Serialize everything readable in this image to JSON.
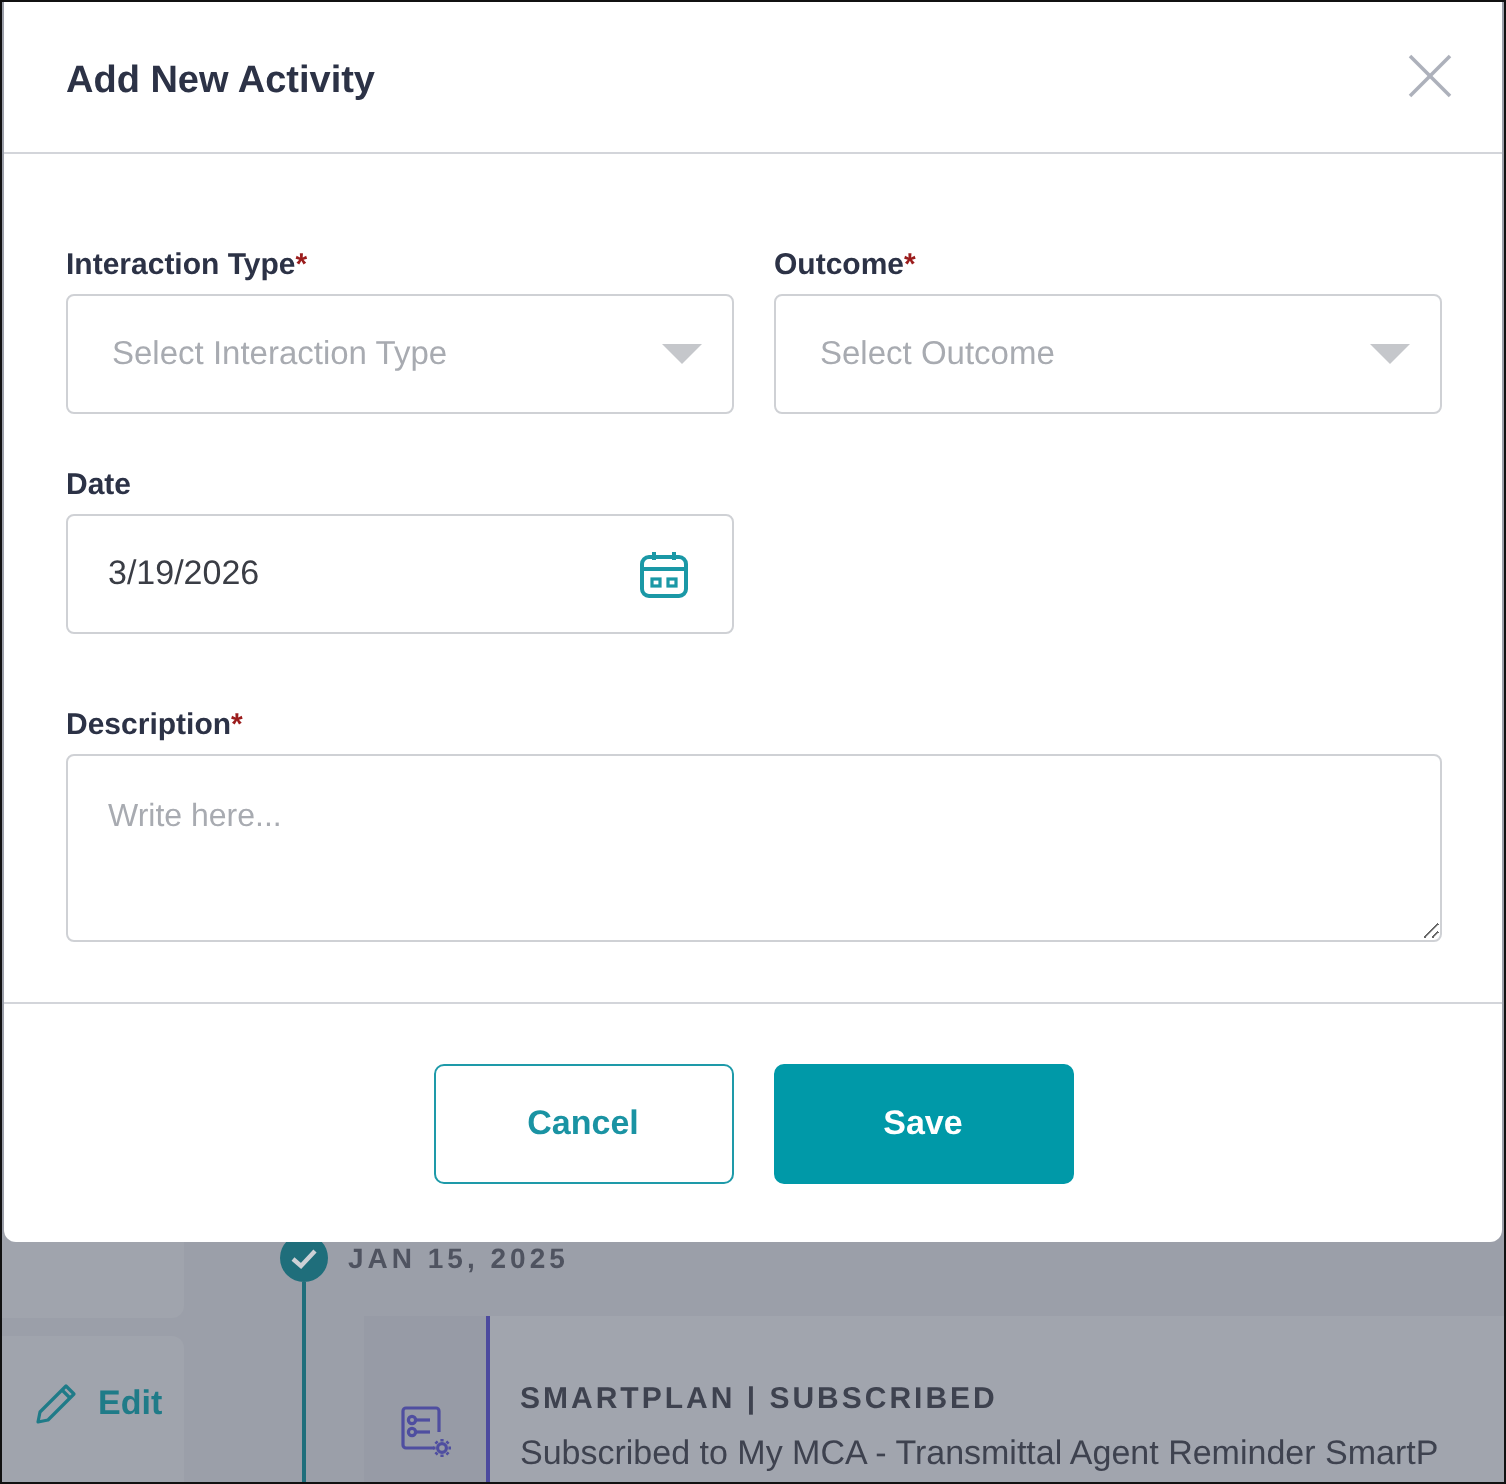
{
  "dialog": {
    "title": "Add New Activity",
    "fields": [
      {
        "kind": "dropdown",
        "label": "Interaction Type",
        "required_mark": "*",
        "placeholder": "Select Interaction Type"
      },
      {
        "kind": "dropdown",
        "label": "Outcome",
        "required_mark": "*",
        "placeholder": "Select Outcome"
      },
      {
        "kind": "date",
        "label": "Date",
        "value": "3/19/2026"
      },
      {
        "kind": "textarea",
        "label": "Description",
        "required_mark": "*",
        "placeholder": "Write here..."
      }
    ],
    "buttons": [
      {
        "kind": "secondary",
        "label": "Cancel"
      },
      {
        "kind": "primary",
        "label": "Save"
      }
    ]
  },
  "background": {
    "side_panel": {
      "edit_label": "Edit"
    },
    "timeline": [
      {
        "date": "JAN 15, 2025",
        "completed": true,
        "entries": [
          {
            "heading": "SMARTPLAN | SUBSCRIBED",
            "text": "Subscribed to My MCA - Transmittal Agent Reminder SmartP"
          }
        ]
      }
    ]
  }
}
